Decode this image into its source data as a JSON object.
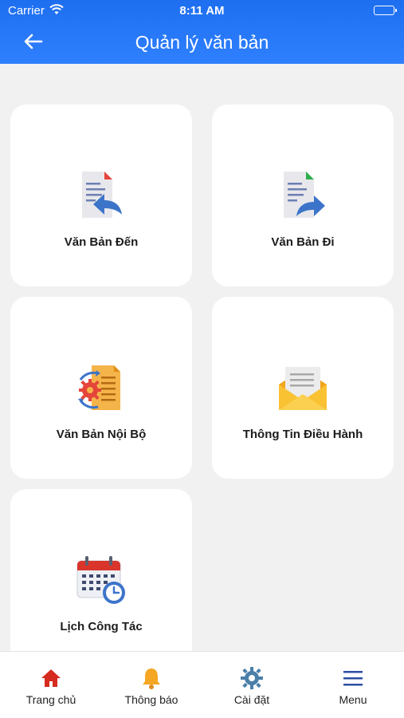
{
  "status_bar": {
    "carrier": "Carrier",
    "time": "8:11 AM"
  },
  "header": {
    "title": "Quản lý văn bản"
  },
  "cards": [
    {
      "label": "Văn Bản Đến",
      "icon": "incoming-document-icon"
    },
    {
      "label": "Văn Bản Đi",
      "icon": "outgoing-document-icon"
    },
    {
      "label": "Văn Bản Nội Bộ",
      "icon": "internal-document-icon"
    },
    {
      "label": "Thông Tin Điều Hành",
      "icon": "envelope-icon"
    },
    {
      "label": "Lịch Công Tác",
      "icon": "calendar-clock-icon"
    }
  ],
  "tabbar": [
    {
      "label": "Trang chủ",
      "icon": "home-icon",
      "color": "#d62b1f"
    },
    {
      "label": "Thông báo",
      "icon": "bell-icon",
      "color": "#f5a623"
    },
    {
      "label": "Cài đặt",
      "icon": "gear-icon",
      "color": "#4a7fa8"
    },
    {
      "label": "Menu",
      "icon": "menu-icon",
      "color": "#2c4fa3"
    }
  ],
  "colors": {
    "header": "#2a7af7",
    "background": "#f1f1f1"
  }
}
